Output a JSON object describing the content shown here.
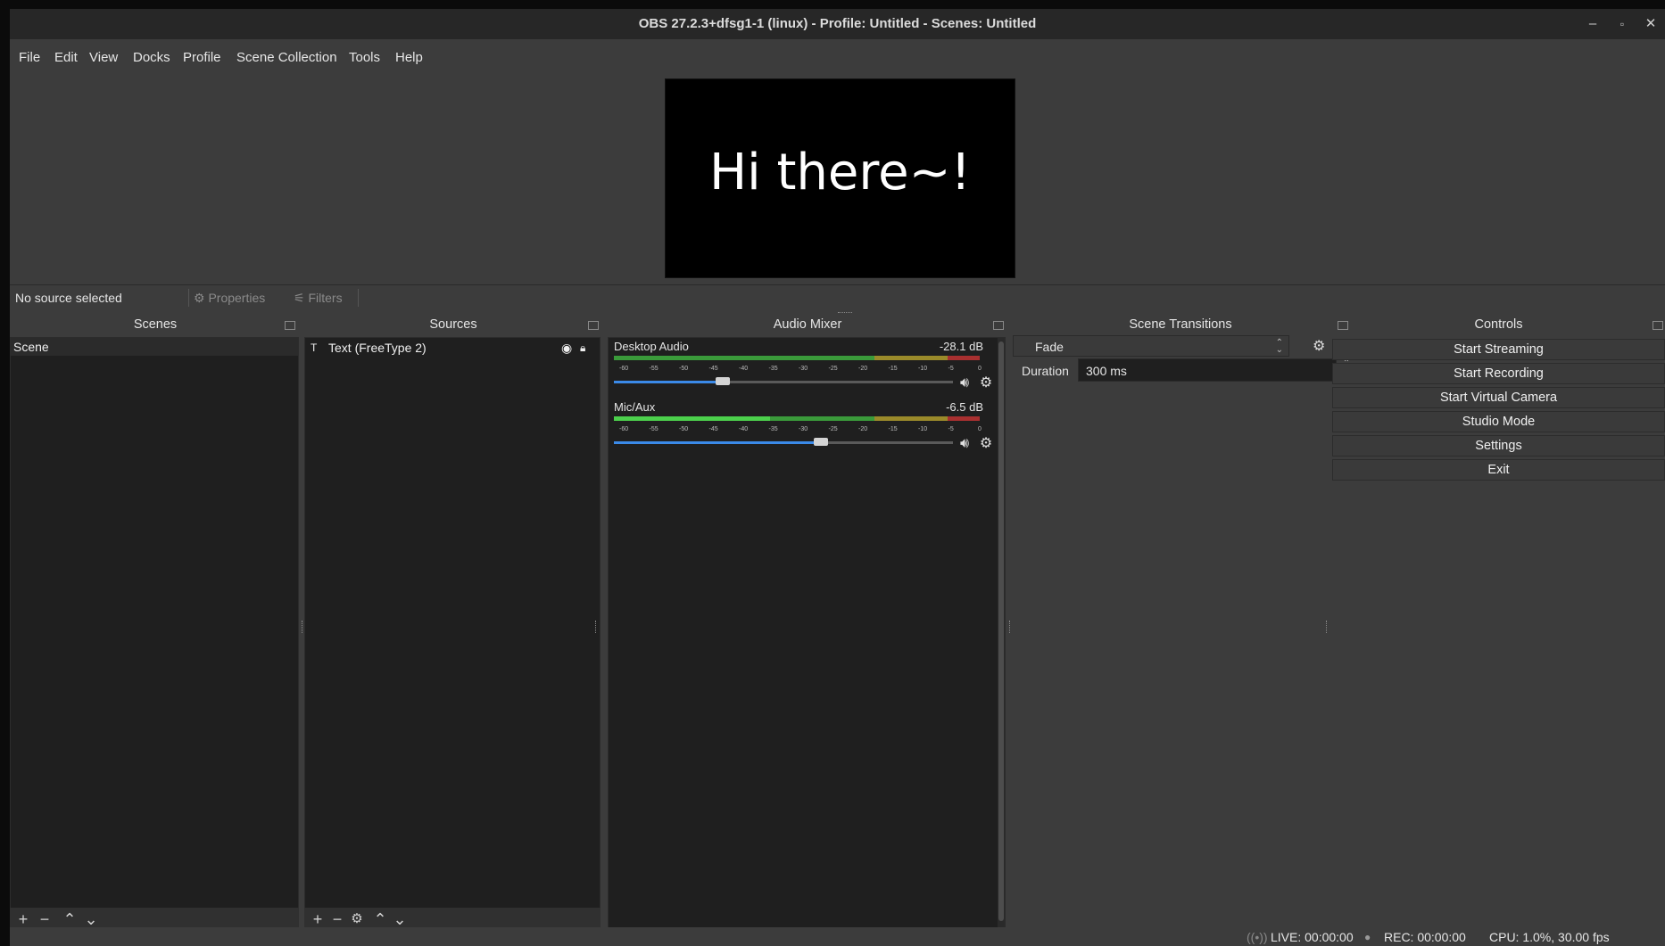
{
  "window": {
    "title": "OBS 27.2.3+dfsg1-1 (linux) - Profile: Untitled - Scenes: Untitled",
    "minimize_icon": "minimize-icon",
    "maximize_icon": "maximize-icon",
    "close_icon": "close-icon"
  },
  "menu": [
    "File",
    "Edit",
    "View",
    "Docks",
    "Profile",
    "Scene Collection",
    "Tools",
    "Help"
  ],
  "preview": {
    "text": "Hi there~!"
  },
  "source_toolbar": {
    "no_source": "No source selected",
    "properties": "Properties",
    "filters": "Filters"
  },
  "scenes": {
    "title": "Scenes",
    "items": [
      "Scene"
    ]
  },
  "sources": {
    "title": "Sources",
    "items": [
      {
        "label": "Text (FreeType 2)",
        "visible": true,
        "locked": false
      }
    ]
  },
  "audio_mixer": {
    "title": "Audio Mixer",
    "channels": [
      {
        "name": "Desktop Audio",
        "db": "-28.1 dB",
        "volume": 0.32
      },
      {
        "name": "Mic/Aux",
        "db": "-6.5 dB",
        "volume": 0.61
      }
    ],
    "tick_labels": [
      "-60",
      "-55",
      "-50",
      "-45",
      "-40",
      "-35",
      "-30",
      "-25",
      "-20",
      "-15",
      "-10",
      "-5",
      "0"
    ]
  },
  "scene_transitions": {
    "title": "Scene Transitions",
    "selected": "Fade",
    "duration_label": "Duration",
    "duration_value": "300 ms"
  },
  "controls": {
    "title": "Controls",
    "buttons": [
      "Start Streaming",
      "Start Recording",
      "Start Virtual Camera",
      "Studio Mode",
      "Settings",
      "Exit"
    ]
  },
  "status": {
    "live": "LIVE: 00:00:00",
    "rec": "REC: 00:00:00",
    "cpu": "CPU: 1.0%, 30.00 fps"
  },
  "colors": {
    "meter_green": "#3a9a3a",
    "meter_yellow": "#9a8a2a",
    "meter_red": "#a83030",
    "slider_blue": "#3b8ae8"
  }
}
